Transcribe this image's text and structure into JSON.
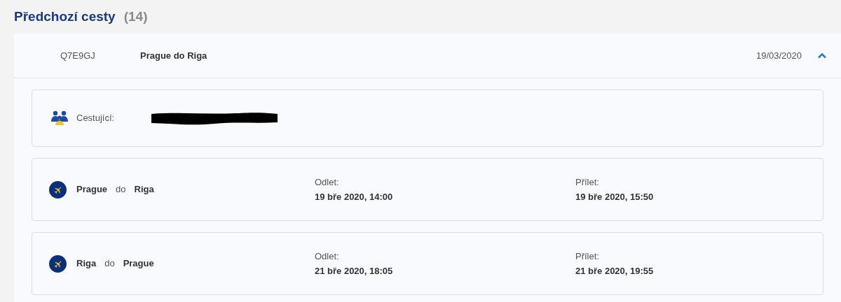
{
  "section": {
    "title": "Předchozí cesty",
    "count": "(14)"
  },
  "trip": {
    "code": "Q7E9GJ",
    "route": "Prague do Riga",
    "date": "19/03/2020",
    "expanded": true,
    "passengers": {
      "label": "Cestující:"
    },
    "flights": [
      {
        "from": "Prague",
        "connector": "do",
        "to": "Riga",
        "departure_label": "Odlet:",
        "departure": "19 bře 2020, 14:00",
        "arrival_label": "Přílet:",
        "arrival": "19 bře 2020, 15:50"
      },
      {
        "from": "Riga",
        "connector": "do",
        "to": "Prague",
        "departure_label": "Odlet:",
        "departure": "21 bře 2020, 18:05",
        "arrival_label": "Přílet:",
        "arrival": "21 bře 2020, 19:55"
      }
    ]
  }
}
